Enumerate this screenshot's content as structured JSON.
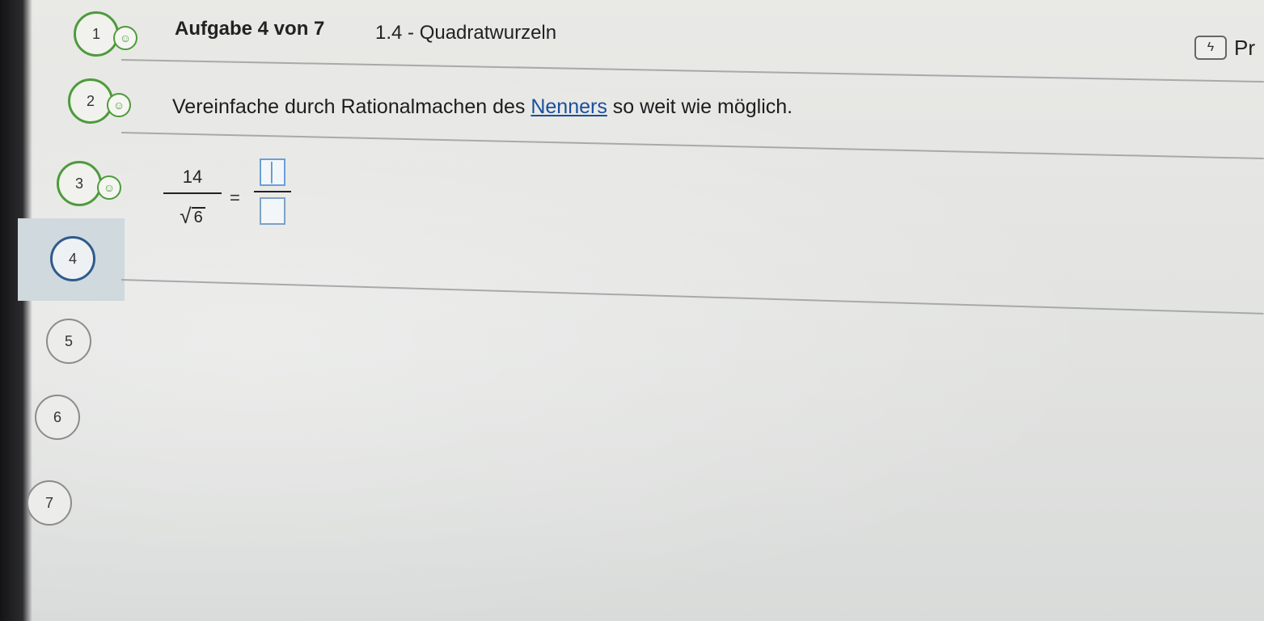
{
  "header": {
    "title": "Aufgabe 4 von 7",
    "subtitle": "1.4 - Quadratwurzeln",
    "hint_icon": "lightning-icon",
    "cut_label": "Pr"
  },
  "sidebar": {
    "steps": [
      {
        "label": "1",
        "state": "done"
      },
      {
        "label": "2",
        "state": "done"
      },
      {
        "label": "3",
        "state": "done"
      },
      {
        "label": "4",
        "state": "active"
      },
      {
        "label": "5",
        "state": "pending"
      },
      {
        "label": "6",
        "state": "pending"
      },
      {
        "label": "7",
        "state": "pending"
      }
    ],
    "done_icon": "smiley-icon"
  },
  "task": {
    "instruction_before": "Vereinfache durch Rationalmachen des ",
    "instruction_link": "Nenners",
    "instruction_after": " so weit wie möglich.",
    "numerator": "14",
    "sqrt_symbol": "√",
    "radicand": "6",
    "equals": "=",
    "answer_numerator": "",
    "answer_denominator": ""
  },
  "colors": {
    "done": "#4d9b3c",
    "active": "#2f5a8e",
    "link": "#1a4f9c",
    "input_border": "#6aa0d8"
  }
}
